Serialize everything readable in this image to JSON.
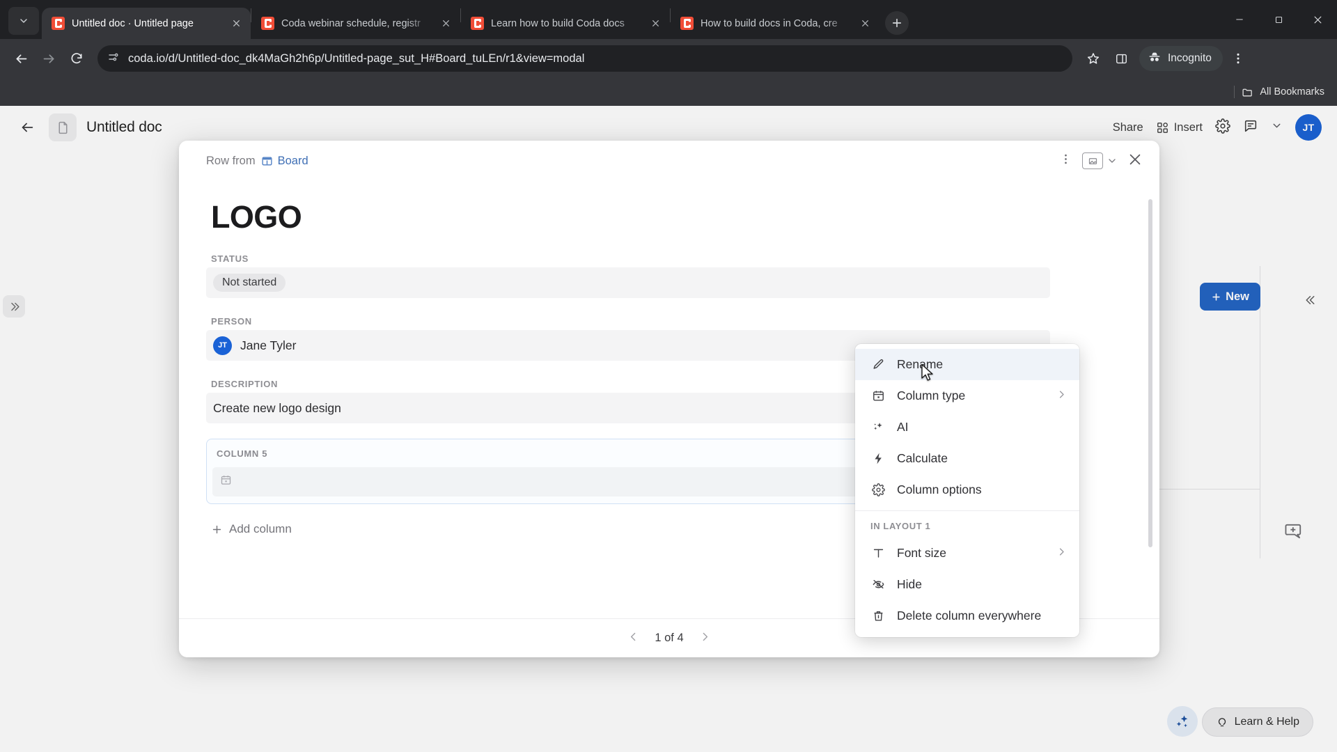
{
  "browser": {
    "tabs": [
      {
        "title": "Untitled doc · Untitled page",
        "active": true
      },
      {
        "title": "Coda webinar schedule, registr",
        "active": false
      },
      {
        "title": "Learn how to build Coda docs",
        "active": false
      },
      {
        "title": "How to build docs in Coda, cre",
        "active": false
      }
    ],
    "omnibox": {
      "url": "coda.io/d/Untitled-doc_dk4MaGh2h6p/Untitled-page_sut_H#Board_tuLEn/r1&view=modal"
    },
    "profile_label": "Incognito",
    "bookmarks_label": "All Bookmarks",
    "icons": {
      "tab_search": "chevron-down-icon",
      "back": "back-arrow-icon",
      "forward": "forward-arrow-icon",
      "reload": "reload-icon",
      "site_info": "site-settings-icon",
      "bookmark": "star-icon",
      "side_panel": "side-panel-icon",
      "menu": "three-dot-menu-icon",
      "minimize": "minimize-icon",
      "maximize": "maximize-icon",
      "close": "close-icon"
    }
  },
  "coda_header": {
    "doc_title": "Untitled doc",
    "share_label": "Share",
    "insert_label": "Insert",
    "avatar_initials": "JT"
  },
  "background": {
    "new_button_label": "New",
    "learn_help_label": "Learn & Help"
  },
  "modal": {
    "breadcrumb_prefix": "Row from",
    "breadcrumb_table": "Board",
    "row_title": "LOGO",
    "fields": [
      {
        "label": "STATUS",
        "type": "pill",
        "value": "Not started"
      },
      {
        "label": "PERSON",
        "type": "person",
        "value": "Jane Tyler",
        "initials": "JT"
      },
      {
        "label": "DESCRIPTION",
        "type": "text",
        "value": "Create new logo design"
      }
    ],
    "selected_column": {
      "label": "COLUMN 5",
      "value": "",
      "type_icon": "calendar-icon"
    },
    "add_column_label": "Add column",
    "pager": {
      "label": "1 of 4"
    }
  },
  "context_menu": {
    "items": [
      {
        "label": "Rename",
        "icon": "pencil-icon",
        "highlighted": true,
        "submenu": false
      },
      {
        "label": "Column type",
        "icon": "calendar-icon",
        "highlighted": false,
        "submenu": true
      },
      {
        "label": "AI",
        "icon": "sparkles-icon",
        "highlighted": false,
        "submenu": false
      },
      {
        "label": "Calculate",
        "icon": "lightning-icon",
        "highlighted": false,
        "submenu": false
      },
      {
        "label": "Column options",
        "icon": "gear-icon",
        "highlighted": false,
        "submenu": false
      }
    ],
    "section_label": "IN LAYOUT 1",
    "section_items": [
      {
        "label": "Font size",
        "icon": "text-size-icon",
        "submenu": true
      },
      {
        "label": "Hide",
        "icon": "eye-off-icon",
        "submenu": false
      },
      {
        "label": "Delete column everywhere",
        "icon": "trash-icon",
        "submenu": false
      }
    ]
  },
  "colors": {
    "accent_blue": "#2364c4",
    "avatar_blue": "#1a62d6",
    "coda_red": "#f04d37",
    "menu_highlight": "#eff3f9",
    "field_bg": "#f4f4f5"
  }
}
